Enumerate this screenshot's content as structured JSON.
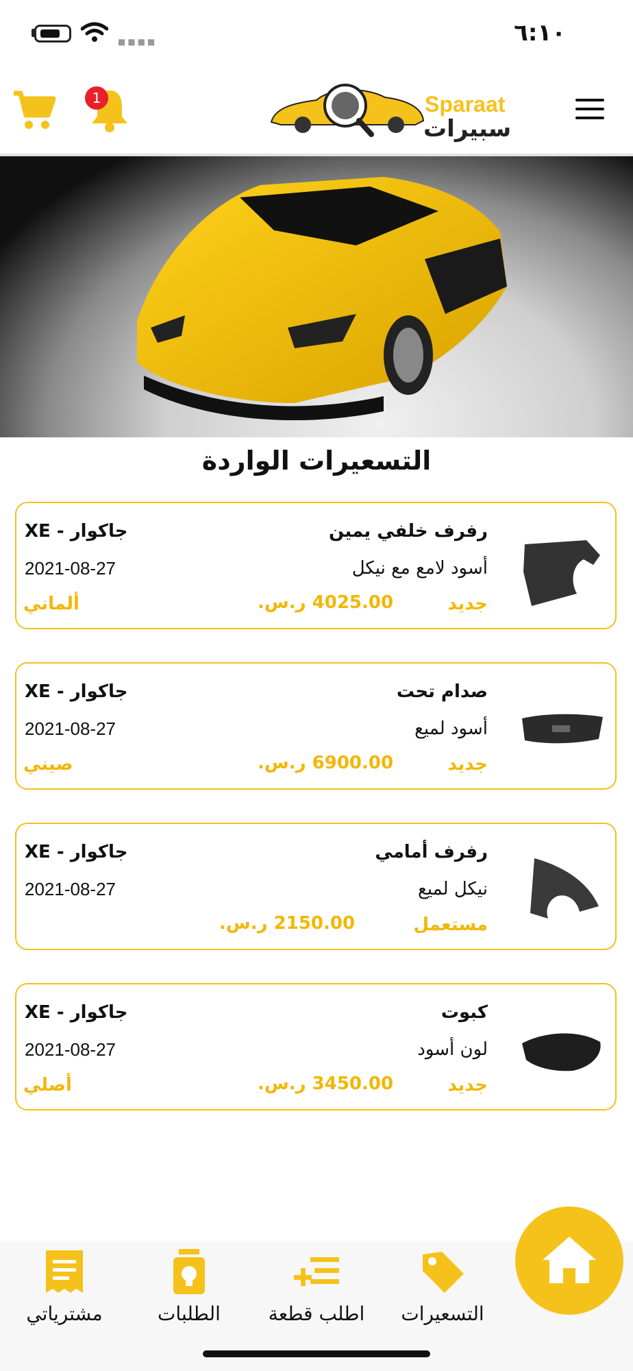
{
  "status_bar": {
    "time": "٦:١٠"
  },
  "header": {
    "notification_count": "1",
    "logo_text_en": "Sparaat",
    "logo_text_ar": "سبيرات"
  },
  "section_title": "التسعيرات الواردة",
  "quotes": [
    {
      "part": "رفرف خلفي يمين",
      "color": "أسود لامع مع نيكل",
      "condition": "جديد",
      "price": "4025.00 ر.س.",
      "car": "جاكوار - XE",
      "date": "2021-08-27",
      "origin": "ألماني",
      "thumb": "fender-icon"
    },
    {
      "part": "صدام تحت",
      "color": "أسود لميع",
      "condition": "جديد",
      "price": "6900.00 ر.س.",
      "car": "جاكوار - XE",
      "date": "2021-08-27",
      "origin": "صيني",
      "thumb": "bumper-icon"
    },
    {
      "part": "رفرف أمامي",
      "color": "نيكل لميع",
      "condition": "مستعمل",
      "price": "2150.00 ر.س.",
      "car": "جاكوار - XE",
      "date": "2021-08-27",
      "origin": "",
      "thumb": "front-fender-icon"
    },
    {
      "part": "كبوت",
      "color": "لون أسود",
      "condition": "جديد",
      "price": "3450.00 ر.س.",
      "car": "جاكوار - XE",
      "date": "2021-08-27",
      "origin": "أصلي",
      "thumb": "hood-icon"
    }
  ],
  "bottom_nav": {
    "pricing": "التسعيرات",
    "request_part": "اطلب قطعة",
    "orders": "الطلبات",
    "purchases": "مشترياتي"
  },
  "colors": {
    "accent": "#f5c21b",
    "badge": "#e8202b"
  }
}
